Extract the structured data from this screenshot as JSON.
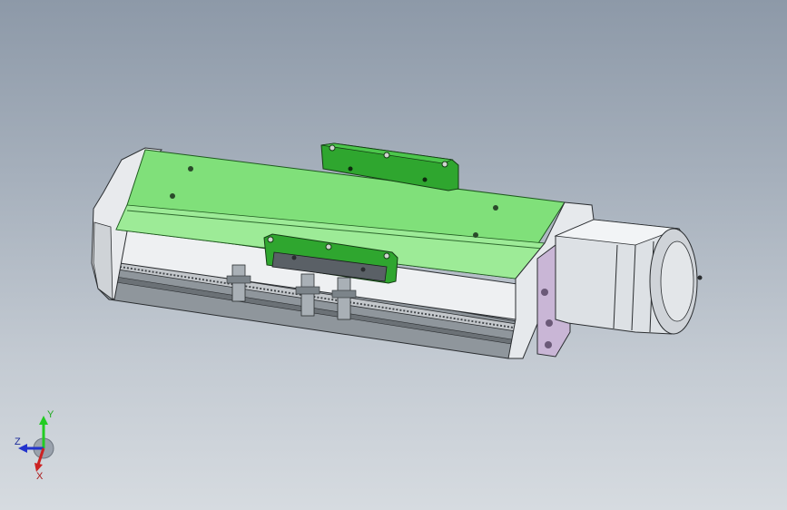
{
  "viewport": {
    "background_top": "#8d99a8",
    "background_bottom": "#d6dbe0"
  },
  "model": {
    "carriage_color": "#7fe07a",
    "bracket_color": "#2fa62f",
    "housing_color": "#e9ecef",
    "rail_color": "#9ea4aa",
    "motor_color": "#d9dde1"
  },
  "triad": {
    "y_label": "Y",
    "z_label": "Z",
    "x_label": "X",
    "y_color": "#22cc22",
    "z_color": "#2233cc",
    "x_color": "#cc2222"
  }
}
